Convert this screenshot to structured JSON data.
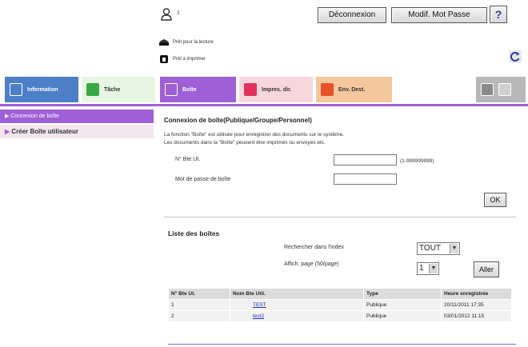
{
  "header": {
    "user_number": "1",
    "logout_label": "Déconnexion",
    "change_password_label": "Modif. Mot Passe",
    "help_label": "?"
  },
  "status": {
    "ready_read": "Prêt pour la lecture",
    "ready_print": "Prêt à imprimer"
  },
  "nav": {
    "tabs": [
      {
        "label": "Information"
      },
      {
        "label": "Tâche"
      },
      {
        "label": "Boîte"
      },
      {
        "label": "Impres. dir."
      },
      {
        "label": "Env. Dest."
      }
    ]
  },
  "sidebar": {
    "items": [
      {
        "label": "Connexion de boîte"
      },
      {
        "label": "Créer Boîte utilisateur"
      }
    ]
  },
  "login": {
    "title": "Connexion de boîte(Publique/Groupe/Personnel)",
    "desc_line1": "La fonction \"Boîte\" est utilisée pour enregistrer des documents sur le système.",
    "desc_line2": "Les documents dans la \"Boîte\" peuvent être imprimés ou envoyés etc.",
    "box_number_label": "N° Bte Ut.",
    "box_number_value": "",
    "box_number_range": "(1-999999999)",
    "password_label": "Mot de passe de boîte",
    "password_value": "",
    "ok_label": "OK"
  },
  "list": {
    "title": "Liste des boîtes",
    "search_label": "Rechercher dans l'index",
    "search_value": "TOUT",
    "page_label": "Affich. page (50/page)",
    "page_value": "1",
    "go_label": "Aller",
    "headers": [
      "N° Bte Ut.",
      "Nom Bte Util.",
      "Type",
      "Heure enregistrée"
    ],
    "rows": [
      {
        "num": "1",
        "name": "TEST",
        "type": "Publique",
        "time": "20/11/2011 17:35"
      },
      {
        "num": "2",
        "name": "test2",
        "type": "Publique",
        "time": "03/01/2012 11:15"
      }
    ]
  },
  "colors": {
    "accent": "#9f5fd6",
    "info_tab": "#4d7fc8",
    "link": "#1a2fb0"
  }
}
